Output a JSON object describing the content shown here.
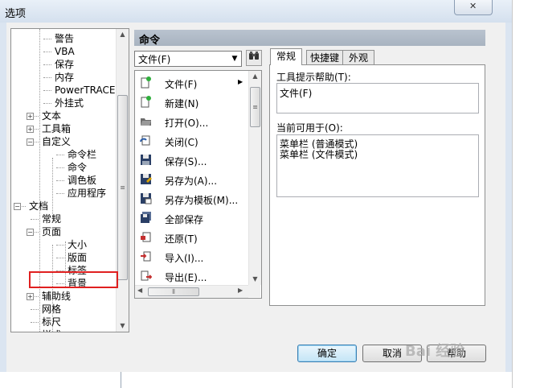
{
  "window": {
    "title": "选项",
    "close_glyph": "✕"
  },
  "tree": {
    "items": [
      {
        "label": "警告"
      },
      {
        "label": "VBA"
      },
      {
        "label": "保存"
      },
      {
        "label": "内存"
      },
      {
        "label": "PowerTRACE"
      },
      {
        "label": "外挂式"
      },
      {
        "label": "文本",
        "expander": "+"
      },
      {
        "label": "工具箱",
        "expander": "+"
      },
      {
        "label": "自定义",
        "expander": "−"
      },
      {
        "label": "命令栏"
      },
      {
        "label": "命令"
      },
      {
        "label": "调色板"
      },
      {
        "label": "应用程序"
      },
      {
        "label": "文档",
        "expander": "−"
      },
      {
        "label": "常规"
      },
      {
        "label": "页面",
        "expander": "−"
      },
      {
        "label": "大小"
      },
      {
        "label": "版面"
      },
      {
        "label": "标签"
      },
      {
        "label": "背景"
      },
      {
        "label": "辅助线",
        "expander": "+"
      },
      {
        "label": "网格"
      },
      {
        "label": "标尺"
      },
      {
        "label": "样式"
      }
    ],
    "highlighted_item": "背景",
    "highlight_color": "#e02020"
  },
  "commands": {
    "header": "命令",
    "category_select": "文件(F)",
    "find_icon": "binoculars-icon",
    "list": [
      {
        "label": "文件(F)",
        "icon": "file-icon",
        "has_submenu": true
      },
      {
        "label": "新建(N)",
        "icon": "new-doc-icon"
      },
      {
        "label": "打开(O)...",
        "icon": "open-folder-icon"
      },
      {
        "label": "关闭(C)",
        "icon": "close-doc-icon"
      },
      {
        "label": "保存(S)...",
        "icon": "save-icon"
      },
      {
        "label": "另存为(A)...",
        "icon": "save-as-icon"
      },
      {
        "label": "另存为模板(M)...",
        "icon": "save-template-icon"
      },
      {
        "label": "全部保存",
        "icon": "save-all-icon"
      },
      {
        "label": "还原(T)",
        "icon": "revert-icon"
      },
      {
        "label": "导入(I)...",
        "icon": "import-icon"
      },
      {
        "label": "导出(E)...",
        "icon": "export-icon"
      }
    ]
  },
  "tabs": [
    {
      "label": "常规",
      "active": true
    },
    {
      "label": "快捷键",
      "active": false
    },
    {
      "label": "外观",
      "active": false
    }
  ],
  "general_tab": {
    "tooltip_label": "工具提示帮助(T):",
    "tooltip_value": "文件(F)",
    "available_label": "当前可用于(O):",
    "available_values": [
      "菜单栏 (普通模式)",
      "菜单栏 (文件模式)"
    ]
  },
  "buttons": {
    "ok": "确定",
    "cancel": "取消",
    "help": "帮助"
  },
  "watermark": "Bai 经验"
}
